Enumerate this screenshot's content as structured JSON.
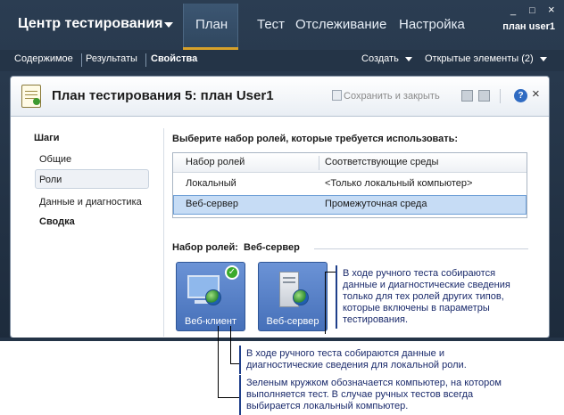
{
  "app": {
    "title": "Центр тестирования",
    "user": "план user1",
    "window_controls": [
      "_",
      "□",
      "×"
    ]
  },
  "topnav": {
    "tabs": [
      {
        "label": "План",
        "active": true
      },
      {
        "label": "Тест",
        "active": false
      },
      {
        "label": "Отслеживание",
        "active": false
      },
      {
        "label": "Настройка",
        "active": false
      }
    ]
  },
  "subnav": {
    "items": [
      "Содержимое",
      "Результаты",
      "Свойства"
    ],
    "create": "Создать",
    "open_items": "Открытые элементы (2)"
  },
  "panel": {
    "title": "План тестирования 5: план User1",
    "save_close": "Сохранить и закрыть",
    "help": "?",
    "close": "×"
  },
  "steps": {
    "title": "Шаги",
    "items": [
      {
        "label": "Общие",
        "selected": false,
        "bold": false
      },
      {
        "label": "Роли",
        "selected": true,
        "bold": false
      },
      {
        "label": "Данные и диагностика",
        "selected": false,
        "bold": false
      },
      {
        "label": "Сводка",
        "selected": false,
        "bold": true
      }
    ]
  },
  "roles": {
    "prompt": "Выберите набор ролей, которые требуется использовать:",
    "columns": [
      "Набор ролей",
      "Соответствующие среды"
    ],
    "rows": [
      {
        "role": "Локальный",
        "env": "<Только локальный компьютер>",
        "selected": false
      },
      {
        "role": "Веб-сервер",
        "env": "Промежуточная среда",
        "selected": true
      }
    ],
    "set_label": "Набор ролей:",
    "set_value": "Веб-сервер",
    "tiles": [
      {
        "label": "Веб-клиент",
        "icon": "client-computer-icon",
        "local": true
      },
      {
        "label": "Веб-сервер",
        "icon": "server-icon",
        "local": false
      }
    ]
  },
  "callouts": {
    "right": "В ходе ручного теста собираются данные и диагностические сведения только для тех ролей других типов, которые включены в параметры тестирования.",
    "local": "В ходе ручного теста собираются данные и диагностические сведения для локальной роли.",
    "green": "Зеленым кружком обозначается компьютер, на котором выполняется тест. В случае ручных тестов всегда выбирается локальный компьютер."
  },
  "colors": {
    "chrome": "#243447",
    "accent": "#d7a12a",
    "selection": "#c6dcf5",
    "tile": "#4670b9",
    "callout_text": "#1a2a6b"
  }
}
